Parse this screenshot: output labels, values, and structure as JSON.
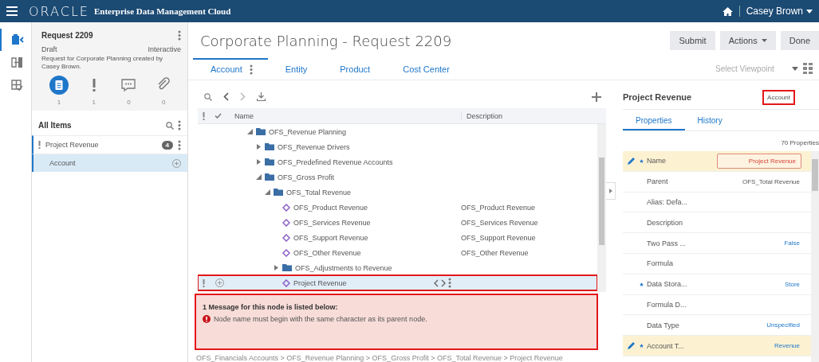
{
  "topbar": {
    "logo": "ORACLE",
    "product": "Enterprise Data Management Cloud",
    "user": "Casey Brown"
  },
  "rail": {
    "items": [
      {
        "kind": "request",
        "selected": true
      },
      {
        "kind": "compare",
        "selected": false
      },
      {
        "kind": "validate",
        "selected": false
      }
    ]
  },
  "request": {
    "title": "Request 2209",
    "status": "Draft",
    "mode": "Interactive",
    "description": "Request for Corporate Planning created by Casey Brown.",
    "counters": [
      {
        "kind": "items",
        "count": "1",
        "selected": true
      },
      {
        "kind": "issues",
        "count": "1",
        "selected": false
      },
      {
        "kind": "comments",
        "count": "0",
        "selected": false
      },
      {
        "kind": "attachments",
        "count": "0",
        "selected": false
      }
    ]
  },
  "items_list": {
    "title": "All Items",
    "items": [
      {
        "name": "Project Revenue",
        "flagged": true,
        "badge": "4",
        "selected": false,
        "children": [
          {
            "name": "Account",
            "selected": true
          }
        ]
      }
    ]
  },
  "main": {
    "title": "Corporate Planning - Request 2209",
    "buttons": [
      {
        "label": "Submit",
        "kind": "plain"
      },
      {
        "label": "Actions",
        "kind": "menu"
      },
      {
        "label": "Done",
        "kind": "plain"
      }
    ],
    "tabs": [
      {
        "label": "Account",
        "selected": true
      },
      {
        "label": "Entity",
        "selected": false
      },
      {
        "label": "Product",
        "selected": false
      },
      {
        "label": "Cost Center",
        "selected": false
      }
    ],
    "viewpoint": {
      "placeholder": "Select Viewpoint"
    }
  },
  "tree": {
    "columns": [
      "Name",
      "Description"
    ],
    "rows": [
      {
        "name": "OFS_Revenue Planning",
        "kind": "folder",
        "expanded": true,
        "selected": false,
        "children": [
          {
            "name": "OFS_Revenue Drivers",
            "kind": "folder",
            "expanded": false,
            "selected": false
          },
          {
            "name": "OFS_Predefined Revenue Accounts",
            "kind": "folder",
            "expanded": false,
            "selected": false
          },
          {
            "name": "OFS_Gross Profit",
            "kind": "folder",
            "expanded": true,
            "selected": false,
            "children": [
              {
                "name": "OFS_Total Revenue",
                "kind": "folder",
                "expanded": true,
                "selected": false,
                "children": [
                  {
                    "name": "OFS_Product Revenue",
                    "kind": "member",
                    "description": "OFS_Product Revenue",
                    "selected": false
                  },
                  {
                    "name": "OFS_Services Revenue",
                    "kind": "member",
                    "description": "OFS_Services Revenue",
                    "selected": false
                  },
                  {
                    "name": "OFS_Support Revenue",
                    "kind": "member",
                    "description": "OFS_Support Revenue",
                    "selected": false
                  },
                  {
                    "name": "OFS_Other Revenue",
                    "kind": "member",
                    "description": "OFS_Other Revenue",
                    "selected": false
                  },
                  {
                    "name": "OFS_Adjustments to Revenue",
                    "kind": "folder",
                    "expanded": false,
                    "selected": false
                  },
                  {
                    "name": "Project Revenue",
                    "kind": "member",
                    "selected": true,
                    "flagged": true,
                    "highlighted": true
                  }
                ]
              }
            ]
          }
        ]
      }
    ]
  },
  "message": {
    "title": "1 Message for this node is listed below:",
    "items": [
      "Node name must begin with the same character as its parent node."
    ],
    "highlighted": true
  },
  "breadcrumb": "OFS_Financials Accounts > OFS_Revenue Planning > OFS_Gross Profit > OFS_Total Revenue > Project Revenue",
  "properties": {
    "node": "Project Revenue",
    "type_badge": "Account",
    "type_highlighted": true,
    "tabs": [
      {
        "label": "Properties",
        "selected": true
      },
      {
        "label": "History",
        "selected": false
      }
    ],
    "count": "70 Properties",
    "rows": [
      {
        "label": "Name",
        "value": "Project Revenue",
        "kind": "field",
        "required": true,
        "edited": true
      },
      {
        "label": "Parent",
        "value": "OFS_Total Revenue",
        "kind": "text",
        "required": false,
        "edited": false
      },
      {
        "label": "Alias: Defa...",
        "required": false,
        "edited": false
      },
      {
        "label": "Description",
        "required": false,
        "edited": false
      },
      {
        "label": "Two Pass ...",
        "value": "False",
        "kind": "link",
        "required": false,
        "edited": false
      },
      {
        "label": "Formula",
        "required": false,
        "edited": false
      },
      {
        "label": "Data Stora...",
        "value": "Store",
        "kind": "link",
        "required": true,
        "edited": false
      },
      {
        "label": "Formula D...",
        "required": false,
        "edited": false
      },
      {
        "label": "Data Type",
        "value": "Unspecified",
        "kind": "link",
        "required": false,
        "edited": false
      },
      {
        "label": "Account T...",
        "value": "Revenue",
        "kind": "link",
        "required": true,
        "edited": true
      }
    ]
  }
}
